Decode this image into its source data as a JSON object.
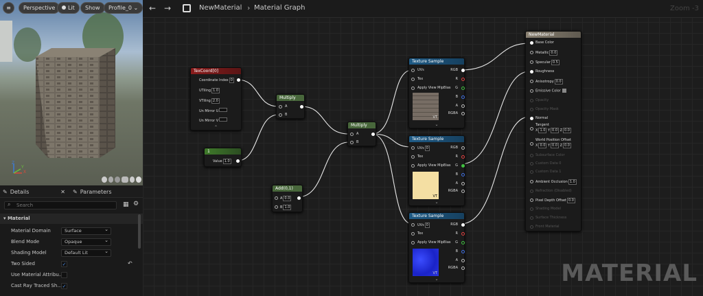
{
  "viewport": {
    "buttons": {
      "menu": "≡",
      "perspective": "Perspective",
      "lit": "Lit",
      "show": "Show",
      "profile": "Profile_0"
    },
    "axes": {
      "z": "Z",
      "x": "X",
      "y": "Y"
    }
  },
  "details": {
    "tab_details": "Details",
    "tab_parameters": "Parameters",
    "search_placeholder": "Search",
    "section": "Material",
    "rows": [
      {
        "label": "Material Domain",
        "value": "Surface"
      },
      {
        "label": "Blend Mode",
        "value": "Opaque"
      },
      {
        "label": "Shading Model",
        "value": "Default Lit"
      },
      {
        "label": "Two Sided",
        "checked": true
      },
      {
        "label": "Use Material Attribu...",
        "checked": false
      },
      {
        "label": "Cast Ray Traced Sh...",
        "checked": true
      }
    ]
  },
  "graph": {
    "breadcrumb": {
      "material": "NewMaterial",
      "separator": "›",
      "graph": "Material Graph"
    },
    "zoom": "Zoom -3",
    "watermark": "MATERIAL",
    "colors": {
      "texcoord": "#8a1c1c",
      "multiply": "#48673b",
      "texture": "#1f5b86",
      "add": "#48673b",
      "output": "#70695e",
      "constant": "#3f7a2a"
    },
    "nodes": {
      "texcoord": {
        "title": "TexCoord[0]",
        "coord_label": "Coordinate Index",
        "coord_value": "0",
        "utiling_label": "UTiling",
        "utiling_value": "1.0",
        "vtiling_label": "VTiling",
        "vtiling_value": "2.0",
        "umirror": "Un Mirror U",
        "vmirror": "Un Mirror V"
      },
      "multiply1": {
        "title": "Multiply",
        "a": "A",
        "b": "B"
      },
      "constant": {
        "title": "1",
        "value_label": "Value",
        "value": "1.0"
      },
      "multiply2": {
        "title": "Multiply",
        "a": "A",
        "b": "B"
      },
      "add": {
        "title": "Add(0,1)",
        "a": "A",
        "a_value": "0.0",
        "b": "B",
        "b_value": "1.0"
      },
      "tex1": {
        "title": "Texture Sample",
        "uvs": "UVs",
        "tex": "Tex",
        "apply": "Apply View MipBias",
        "rgb": "RGB",
        "r": "R",
        "g": "G",
        "b": "B",
        "a": "A",
        "rgba": "RGBA",
        "vt": "VT"
      },
      "tex2": {
        "title": "Texture Sample",
        "uvs": "UVs",
        "uvs_value": "0",
        "tex": "Tex",
        "apply": "Apply View MipBias",
        "rgb": "RGB",
        "r": "R",
        "g": "G",
        "b": "B",
        "a": "A",
        "rgba": "RGBA",
        "vt": "VT"
      },
      "tex3": {
        "title": "Texture Sample",
        "uvs": "UVs",
        "uvs_value": "0",
        "tex": "Tex",
        "apply": "Apply View MipBias",
        "rgb": "RGB",
        "r": "R",
        "g": "G",
        "b": "B",
        "a": "A",
        "rgba": "RGBA",
        "vt": "VT"
      },
      "output": {
        "title": "NewMaterial",
        "base_color": "Base Color",
        "metallic": "Metallic",
        "metallic_value": "0.0",
        "specular": "Specular",
        "specular_value": "0.5",
        "roughness": "Roughness",
        "anisotropy": "Anisotropy",
        "anisotropy_value": "0.0",
        "emissive": "Emissive Color",
        "opacity": "Opacity",
        "opacity_mask": "Opacity Mask",
        "normal": "Normal",
        "tangent": "Tangent",
        "tangent_x": "1.0",
        "tangent_y": "0.0",
        "tangent_z": "0.0",
        "wpo": "World Position Offset",
        "wpo_x": "0.0",
        "wpo_y": "0.0",
        "wpo_z": "0.0",
        "subsurface": "Subsurface Color",
        "custom0": "Custom Data 0",
        "custom1": "Custom Data 1",
        "ao": "Ambient Occlusion",
        "ao_value": "1.0",
        "refraction": "Refraction (Disabled)",
        "pdo": "Pixel Depth Offset",
        "pdo_value": "0.0",
        "shading_model": "Shading Model",
        "surface_thickness": "Surface Thickness",
        "front_material": "Front Material",
        "axis_x": "X",
        "axis_y": "Y",
        "axis_z": "Z"
      }
    }
  }
}
